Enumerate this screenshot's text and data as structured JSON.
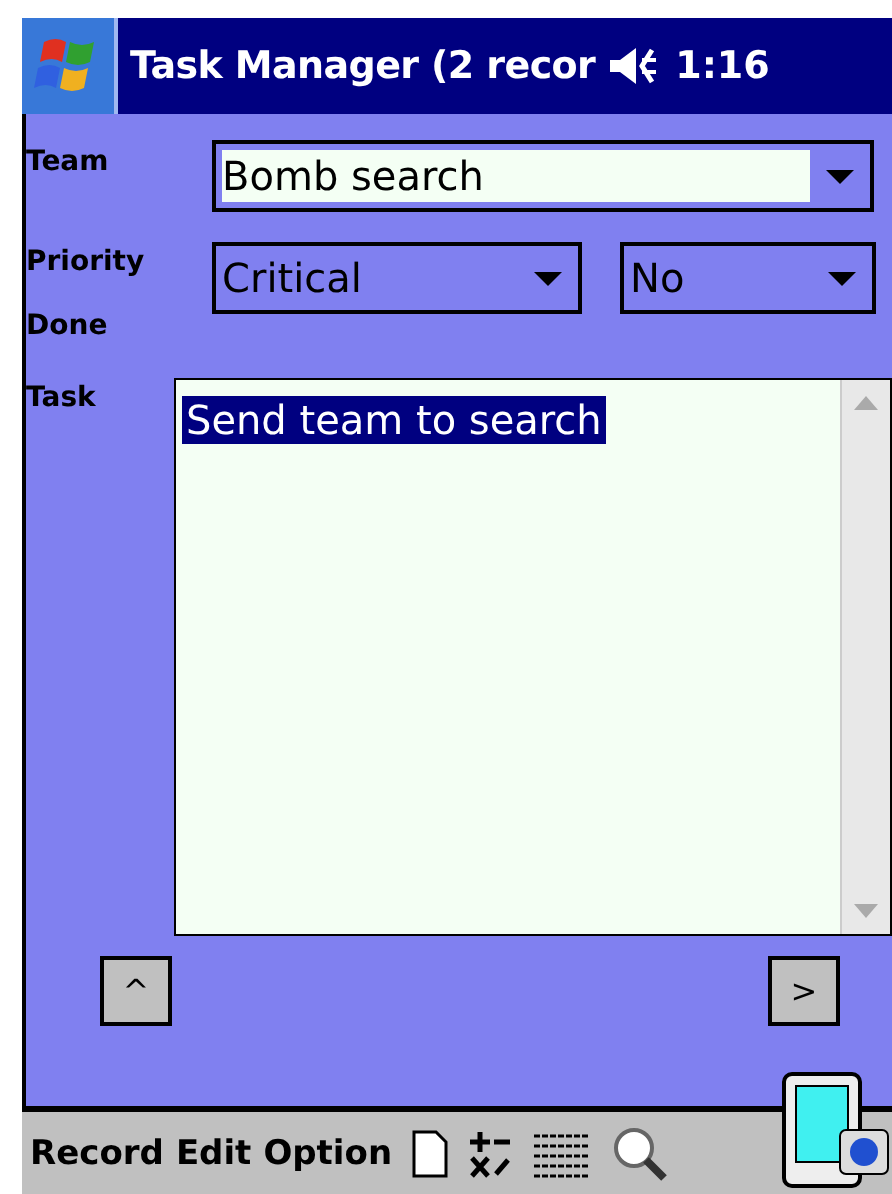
{
  "window": {
    "title": "Task Manager (2 recor",
    "time": "1:16"
  },
  "form": {
    "team": {
      "label": "Team",
      "value": "Bomb search"
    },
    "priority": {
      "label": "Priority",
      "value": "Critical"
    },
    "done": {
      "label": "Done",
      "value": "No"
    },
    "task": {
      "label": "Task",
      "value": "Send team to search",
      "selected": true
    }
  },
  "nav": {
    "up": "^",
    "next": ">"
  },
  "menu_bar": {
    "items": [
      "Record",
      "Edit",
      "Option"
    ]
  }
}
